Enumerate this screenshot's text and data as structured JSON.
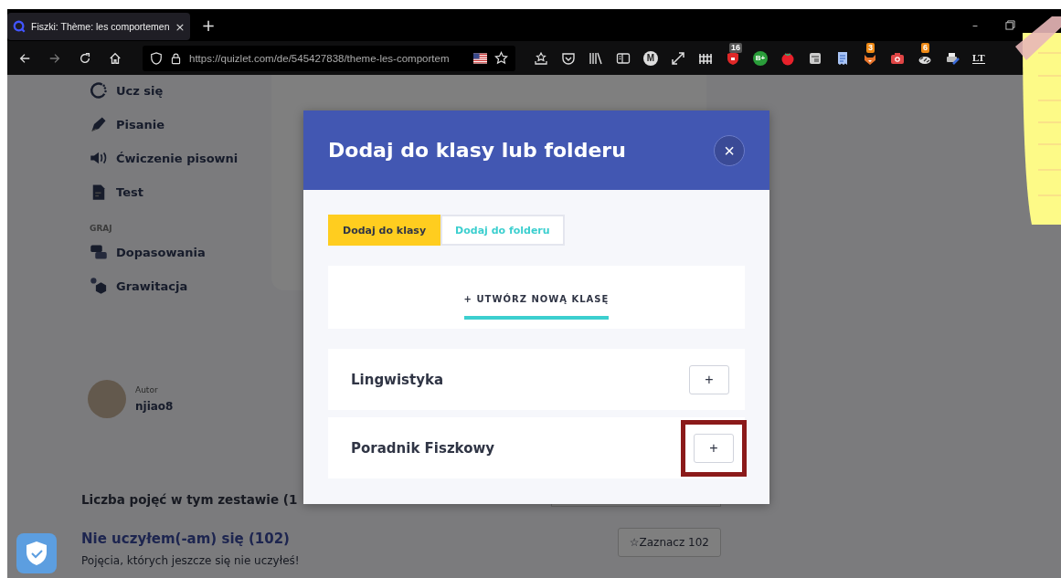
{
  "browser": {
    "tab": {
      "title": "Fiszki: Thème: les comportemen",
      "close": "×"
    },
    "new_tab": "+",
    "window_controls": {
      "minimize": "–"
    },
    "url": "https://quizlet.com/de/545427838/theme-les-comportem",
    "extensions": [
      {
        "kind": "tray-star"
      },
      {
        "kind": "pocket"
      },
      {
        "kind": "library"
      },
      {
        "kind": "reader"
      },
      {
        "kind": "circle-letter",
        "label": "M"
      },
      {
        "kind": "expand"
      },
      {
        "kind": "fence"
      },
      {
        "kind": "shield",
        "badge": "16"
      },
      {
        "kind": "green-circle",
        "label": "B+"
      },
      {
        "kind": "tomato"
      },
      {
        "kind": "panel"
      },
      {
        "kind": "document"
      },
      {
        "kind": "fox",
        "badge": "3"
      },
      {
        "kind": "camera"
      },
      {
        "kind": "cow",
        "badge": "6"
      },
      {
        "kind": "printer"
      },
      {
        "kind": "text-mark",
        "label": "LT"
      }
    ]
  },
  "sidebar": {
    "items": [
      {
        "label": "Ucz się",
        "kind": "learn"
      },
      {
        "label": "Pisanie",
        "kind": "write"
      },
      {
        "label": "Ćwiczenie pisowni",
        "kind": "spell"
      },
      {
        "label": "Test",
        "kind": "test"
      }
    ],
    "section": "GRAJ",
    "games": [
      {
        "label": "Dopasowania",
        "kind": "match"
      },
      {
        "label": "Grawitacja",
        "kind": "gravity"
      }
    ]
  },
  "author": {
    "label": "Autor",
    "name": "njiao8"
  },
  "terms": {
    "heading": "Liczba pojęć w tym zestawie (1",
    "group_title": "Nie uczyłem(-am) się (102)",
    "group_text": "Pojęcia, których jeszcze się nie uczyłeś!",
    "star_button": "☆Zaznacz 102"
  },
  "modal": {
    "title": "Dodaj do klasy lub folderu",
    "close": "×",
    "tabs": [
      {
        "label": "Dodaj do klasy",
        "selected": true
      },
      {
        "label": "Dodaj do folderu",
        "selected": false
      }
    ],
    "create_button": "+ UTWÓRZ NOWĄ KLASĘ",
    "classes": [
      {
        "name": "Lingwistyka",
        "add": "+",
        "highlighted": false
      },
      {
        "name": "Poradnik Fiszkowy",
        "add": "+",
        "highlighted": true
      }
    ]
  }
}
